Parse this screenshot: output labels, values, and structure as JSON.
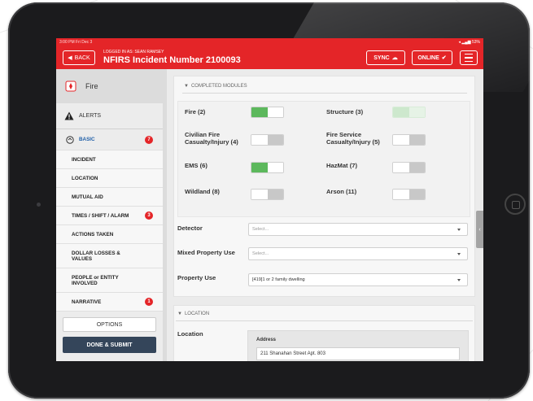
{
  "status_bar": {
    "time": "3:00 PM  Fri Dec 3",
    "right": "◂ ▂▄▆ 53%"
  },
  "header": {
    "back_label": "BACK",
    "logged_in": "LOGGED IN AS: SEAN RAMSEY",
    "title": "NFIRS Incident Number 2100093",
    "sync_label": "SYNC",
    "online_label": "ONLINE"
  },
  "sidebar": {
    "module_name": "Fire",
    "alerts_label": "ALERTS",
    "basic_label": "BASIC",
    "basic_badge": "7",
    "items": [
      {
        "label": "INCIDENT"
      },
      {
        "label": "LOCATION"
      },
      {
        "label": "MUTUAL AID"
      },
      {
        "label": "TIMES / SHIFT / ALARM",
        "badge": "3"
      },
      {
        "label": "ACTIONS TAKEN"
      },
      {
        "label": "DOLLAR LOSSES & VALUES"
      },
      {
        "label": "PEOPLE or ENTITY INVOLVED"
      },
      {
        "label": "NARRATIVE",
        "badge": "1"
      }
    ],
    "options_label": "OPTIONS",
    "done_label": "DONE & SUBMIT"
  },
  "completed_modules": {
    "title": "COMPLETED MODULES",
    "items": [
      {
        "label": "Fire (2)",
        "state": "on"
      },
      {
        "label": "Structure (3)",
        "state": "disabled"
      },
      {
        "label": "Civilian Fire Casualty/Injury (4)",
        "state": "off"
      },
      {
        "label": "Fire Service Casualty/Injury (5)",
        "state": "off"
      },
      {
        "label": "EMS (6)",
        "state": "on"
      },
      {
        "label": "HazMat (7)",
        "state": "off"
      },
      {
        "label": "Wildland (8)",
        "state": "off"
      },
      {
        "label": "Arson (11)",
        "state": "off"
      }
    ]
  },
  "fields": {
    "detector_label": "Detector",
    "detector_placeholder": "Select...",
    "mixed_label": "Mixed Property Use",
    "mixed_placeholder": "Select...",
    "property_label": "Property Use",
    "property_value": "[419]1 or 2 family dwelling"
  },
  "location": {
    "section_title": "LOCATION",
    "label": "Location",
    "address_label": "Address",
    "address_value": "211 Shanahan Street Apt. 803"
  },
  "colors": {
    "header_red": "#e42528",
    "toggle_green": "#5cb85c",
    "basic_blue": "#1f5fa8",
    "submit_dark": "#34455a"
  }
}
